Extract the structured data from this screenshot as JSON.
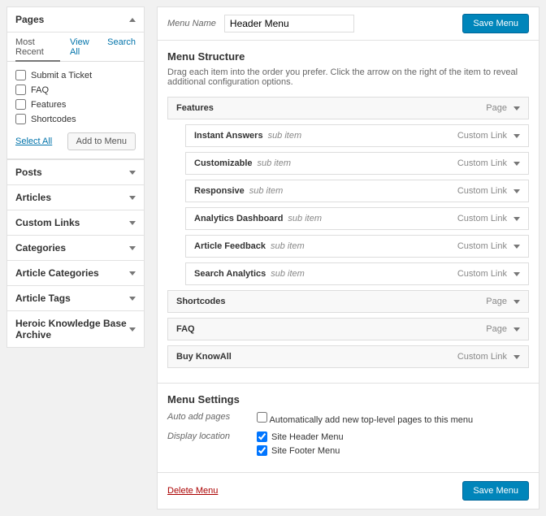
{
  "sidebar": {
    "pages": {
      "title": "Pages",
      "tabs": [
        "Most Recent",
        "View All",
        "Search"
      ],
      "items": [
        "Submit a Ticket",
        "FAQ",
        "Features",
        "Shortcodes"
      ],
      "select_all": "Select All",
      "add": "Add to Menu"
    },
    "panels": [
      "Posts",
      "Articles",
      "Custom Links",
      "Categories",
      "Article Categories",
      "Article Tags",
      "Heroic Knowledge Base Archive"
    ]
  },
  "menu_name": {
    "label": "Menu Name",
    "value": "Header Menu"
  },
  "save": "Save Menu",
  "structure": {
    "title": "Menu Structure",
    "hint": "Drag each item into the order you prefer. Click the arrow on the right of the item to reveal additional configuration options.",
    "items": [
      {
        "title": "Features",
        "type": "Page",
        "sub": false
      },
      {
        "title": "Instant Answers",
        "type": "Custom Link",
        "sub": true
      },
      {
        "title": "Customizable",
        "type": "Custom Link",
        "sub": true
      },
      {
        "title": "Responsive",
        "type": "Custom Link",
        "sub": true
      },
      {
        "title": "Analytics Dashboard",
        "type": "Custom Link",
        "sub": true
      },
      {
        "title": "Article Feedback",
        "type": "Custom Link",
        "sub": true
      },
      {
        "title": "Search Analytics",
        "type": "Custom Link",
        "sub": true
      },
      {
        "title": "Shortcodes",
        "type": "Page",
        "sub": false
      },
      {
        "title": "FAQ",
        "type": "Page",
        "sub": false
      },
      {
        "title": "Buy KnowAll",
        "type": "Custom Link",
        "sub": false
      }
    ],
    "sub_label": "sub item"
  },
  "settings": {
    "title": "Menu Settings",
    "auto": {
      "label": "Auto add pages",
      "opt": "Automatically add new top-level pages to this menu"
    },
    "loc": {
      "label": "Display location",
      "opts": [
        "Site Header Menu",
        "Site Footer Menu"
      ]
    }
  },
  "delete": "Delete Menu"
}
